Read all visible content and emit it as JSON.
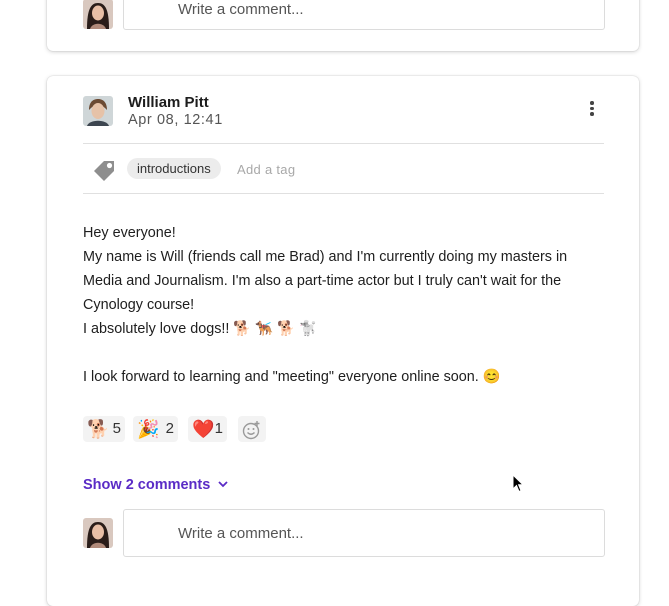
{
  "top_card": {
    "comment_placeholder": "Write a comment..."
  },
  "post": {
    "author_name": "William Pitt",
    "date": "Apr 08, 12:41",
    "tags": [
      "introductions"
    ],
    "add_tag_placeholder": "Add a tag",
    "body_lines": [
      "Hey everyone!",
      "My name is Will (friends call me Brad) and I'm currently doing my masters in Media and Journalism. I'm also a part-time actor but I truly can't wait for the Cynology course!",
      "I absolutely love dogs!! 🐕 🐕‍🦺 🐕 🐩",
      "",
      "I look forward to learning and \"meeting\" everyone online soon. 😊"
    ],
    "reactions": [
      {
        "emoji": "🐕",
        "count": "5"
      },
      {
        "emoji": "🎉",
        "count": "2"
      },
      {
        "emoji": "❤️",
        "count": "1"
      }
    ],
    "show_comments_label": "Show 2 comments",
    "comment_placeholder": "Write a comment..."
  },
  "colors": {
    "accent": "#5a2bc6",
    "tag_bg": "#ececec",
    "reaction_bg": "#f3f3f3"
  },
  "icons": {
    "more": "more-vertical-icon",
    "tag": "tag-icon",
    "add_reaction": "add-reaction-icon",
    "chevron": "chevron-down-icon"
  }
}
